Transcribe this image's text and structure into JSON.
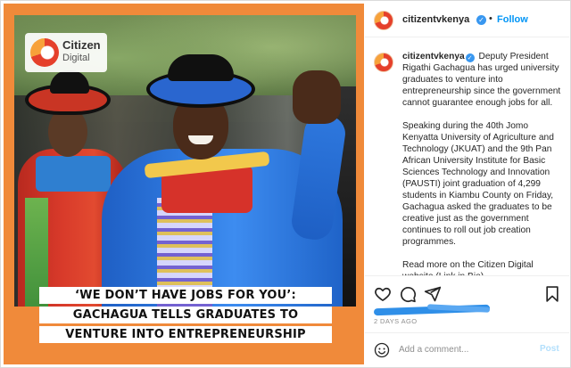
{
  "post_image": {
    "logo": {
      "line1": "Citizen",
      "line2": "Digital"
    },
    "headline": [
      "‘WE DON’T HAVE JOBS FOR YOU’:",
      "GACHAGUA TELLS GRADUATES TO",
      "VENTURE INTO ENTREPRENEURSHIP"
    ]
  },
  "header": {
    "username": "citizentvkenya",
    "separator": "•",
    "follow_label": "Follow"
  },
  "caption": {
    "username": "citizentvkenya",
    "paragraphs": [
      "Deputy President Rigathi Gachagua has urged university graduates to venture into entrepreneurship since the government cannot guarantee enough jobs for all.",
      "Speaking during the 40th Jomo Kenyatta University of Agriculture and Technology (JKUAT) and the 9th Pan African University Institute for Basic Sciences Technology and Innovation (PAUSTI) joint graduation of 4,299 students in Kiambu County on Friday, Gachagua asked the graduates to be creative just as the government continues to roll out job creation programmes.",
      "Read more on the Citizen Digital website (Link in Bio)."
    ]
  },
  "actions": {
    "icons": [
      "heart-icon",
      "comment-icon",
      "share-icon",
      "bookmark-icon"
    ],
    "timestamp": "2 DAYS AGO"
  },
  "comment_bar": {
    "placeholder": "Add a comment...",
    "post_label": "Post"
  },
  "colors": {
    "accent_blue": "#0095f6",
    "frame_orange": "#f08a3a",
    "verified_blue": "#3897f0"
  }
}
